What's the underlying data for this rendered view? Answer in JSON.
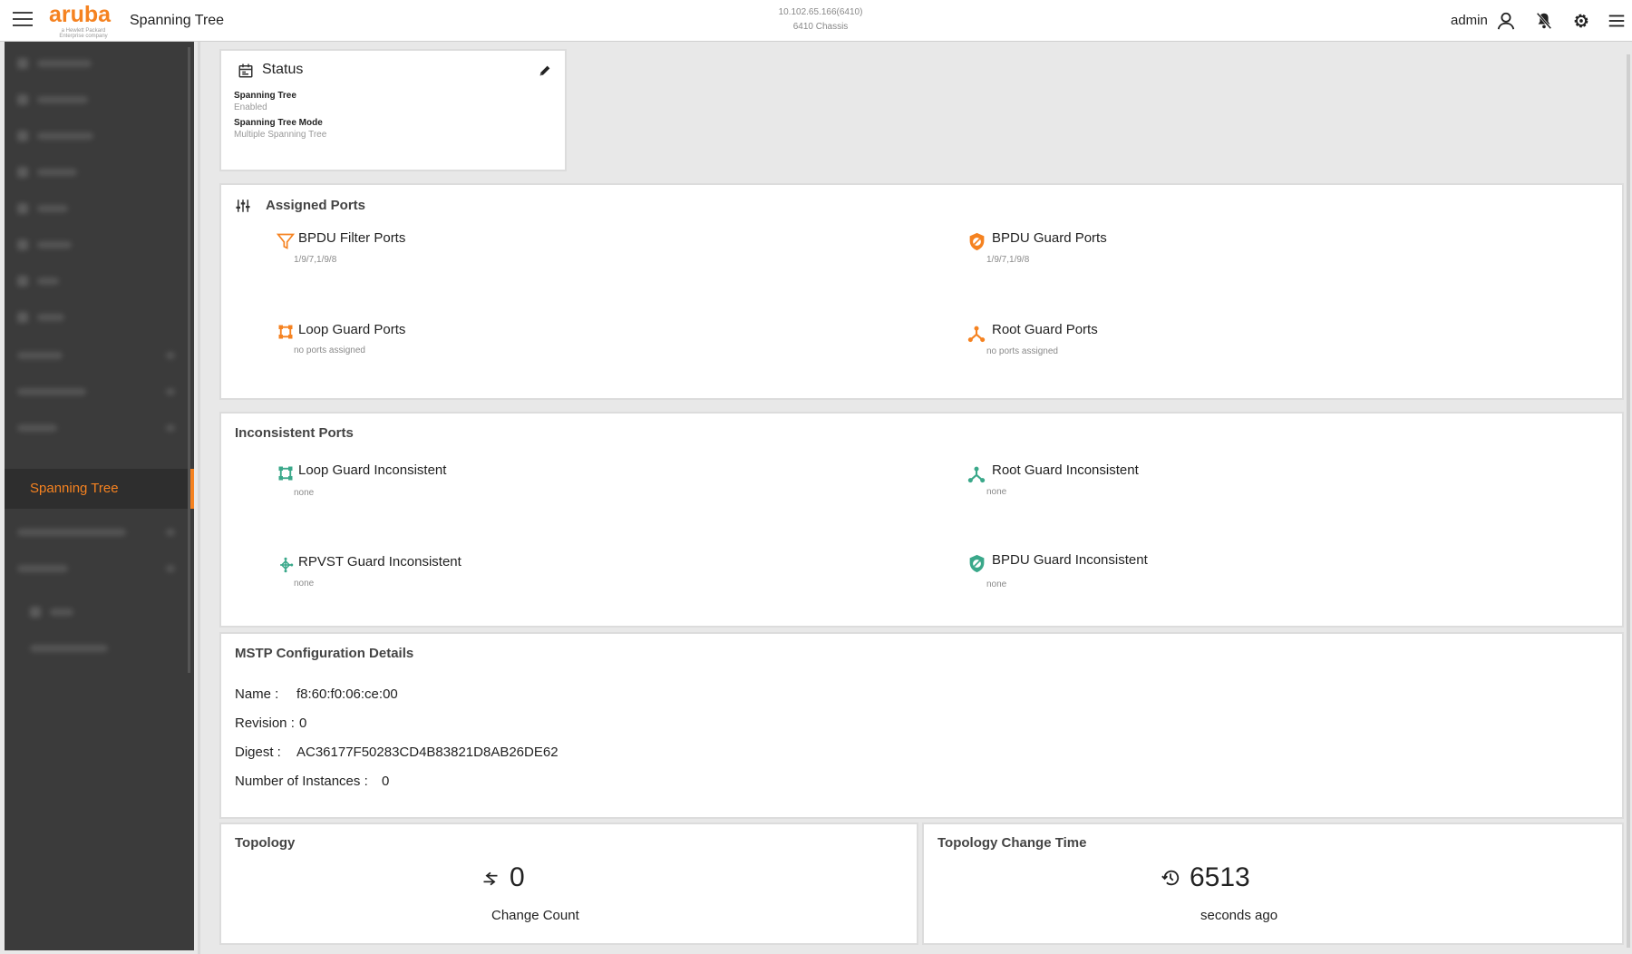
{
  "header": {
    "logo_text": "aruba",
    "logo_tagline": "a Hewlett Packard Enterprise company",
    "page_title": "Spanning Tree",
    "device_address": "10.102.65.166(6410)",
    "device_model": "6410 Chassis",
    "user": "admin"
  },
  "sidebar": {
    "active_item": "Spanning Tree"
  },
  "status": {
    "title": "Status",
    "spanning_tree_label": "Spanning Tree",
    "spanning_tree_value": "Enabled",
    "mode_label": "Spanning Tree Mode",
    "mode_value": "Multiple Spanning Tree"
  },
  "assigned_ports": {
    "title": "Assigned Ports",
    "bpdu_filter": {
      "label": "BPDU Filter Ports",
      "value": "1/9/7,1/9/8"
    },
    "bpdu_guard": {
      "label": "BPDU Guard Ports",
      "value": "1/9/7,1/9/8"
    },
    "loop_guard": {
      "label": "Loop Guard Ports",
      "value": "no ports assigned"
    },
    "root_guard": {
      "label": "Root Guard Ports",
      "value": "no ports assigned"
    }
  },
  "inconsistent_ports": {
    "title": "Inconsistent Ports",
    "loop_guard": {
      "label": "Loop Guard Inconsistent",
      "value": "none"
    },
    "root_guard": {
      "label": "Root Guard Inconsistent",
      "value": "none"
    },
    "rpvst_guard": {
      "label": "RPVST Guard Inconsistent",
      "value": "none"
    },
    "bpdu_guard": {
      "label": "BPDU Guard Inconsistent",
      "value": "none"
    }
  },
  "mstp": {
    "title": "MSTP Configuration Details",
    "name_label": "Name :",
    "name_value": "f8:60:f0:06:ce:00",
    "revision_label": "Revision :",
    "revision_value": "0",
    "digest_label": "Digest :",
    "digest_value": "AC36177F50283CD4B83821D8AB26DE62",
    "instances_label": "Number of Instances :",
    "instances_value": "0"
  },
  "topology": {
    "title": "Topology",
    "change_count": "0",
    "change_count_caption": "Change Count"
  },
  "topology_change_time": {
    "title": "Topology Change Time",
    "seconds": "6513",
    "caption": "seconds ago"
  },
  "colors": {
    "accent": "#f58220",
    "ok_green": "#3aa88a",
    "sidebar_bg": "#3b3b3b"
  },
  "icons": {
    "menu": "hamburger-icon",
    "user": "user-icon",
    "notifications": "notification-off-icon",
    "settings": "gear-icon",
    "more": "hamburger-icon",
    "status": "calendar-icon",
    "edit": "pencil-icon",
    "assigned": "sliders-icon",
    "bpdu_filter": "filter-icon",
    "bpdu_guard": "shield-icon",
    "loop_guard": "loop-icon",
    "root_guard": "tree-icon",
    "rpvst_guard": "network-icon",
    "topology_change": "swap-arrows-icon",
    "history": "history-icon"
  }
}
